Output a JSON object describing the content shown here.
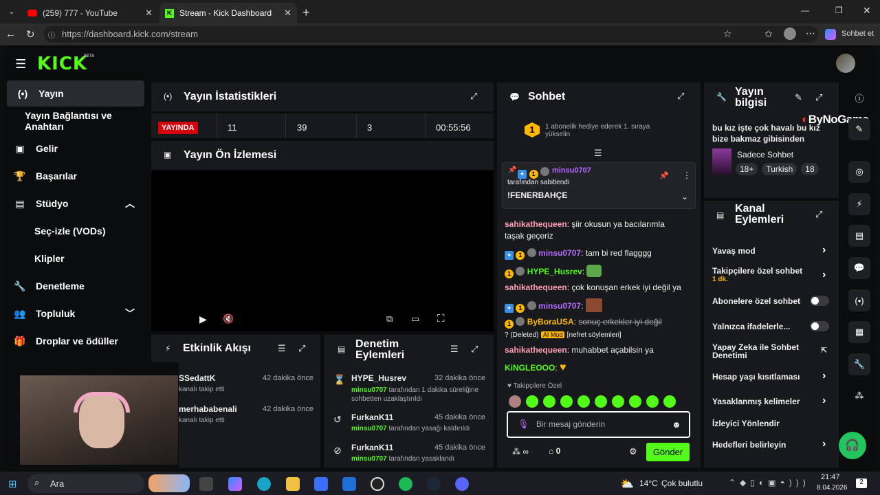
{
  "browser": {
    "tabs": [
      {
        "title": "(259) 777 - YouTube",
        "active": false
      },
      {
        "title": "Stream - Kick Dashboard",
        "active": true
      }
    ],
    "url": "https://dashboard.kick.com/stream",
    "copilot_label": "Sohbet et"
  },
  "brand": {
    "logo": "KICK",
    "beta": "BETA",
    "color": "#53fc18"
  },
  "sidebar": {
    "items": [
      {
        "label": "Yayın",
        "icon": "broadcast-icon",
        "active": true
      },
      {
        "label": "Yayın Bağlantısı ve Anahtarı",
        "icon": ""
      },
      {
        "label": "Gelir",
        "icon": "wallet-icon"
      },
      {
        "label": "Başarılar",
        "icon": "trophy-icon"
      },
      {
        "label": "Stüdyo",
        "icon": "studio-icon"
      },
      {
        "label": "Seç-izle (VODs)",
        "icon": ""
      },
      {
        "label": "Klipler",
        "icon": ""
      },
      {
        "label": "Denetleme",
        "icon": "wrench-icon"
      },
      {
        "label": "Topluluk",
        "icon": "people-icon"
      },
      {
        "label": "Droplar ve ödüller",
        "icon": "gift-icon"
      }
    ]
  },
  "stats": {
    "title": "Yayın İstatistikleri",
    "status": "YAYINDA",
    "values": [
      "11",
      "39",
      "3",
      "00:55:56"
    ]
  },
  "preview": {
    "title": "Yayın Ön İzlemesi"
  },
  "activity": {
    "title": "Etkinlik Akışı",
    "items": [
      {
        "user": "SSedattK",
        "time": "42 dakika önce",
        "desc": "kanalı takip etti"
      },
      {
        "user": "merhababenali",
        "time": "42 dakika önce",
        "desc": "kanalı takip etti"
      }
    ]
  },
  "moderation": {
    "title": "Denetim Eylemleri",
    "items": [
      {
        "user": "HYPE_Husrev",
        "time": "32 dakika önce",
        "actor": "minsu0707",
        "desc": "tarafından 1 dakika süreliğine sohbetten uzaklaştırıldı"
      },
      {
        "user": "FurkanK11",
        "time": "45 dakika önce",
        "actor": "minsu0707",
        "desc": "tarafından yasağı kaldırıldı"
      },
      {
        "user": "FurkanK11",
        "time": "45 dakika önce",
        "actor": "minsu0707",
        "desc": "tarafından yasaklandı"
      }
    ]
  },
  "chat": {
    "title": "Sohbet",
    "sub_gift": "1 abonelik hediye ederek 1. sıraya yükselin",
    "sub_rank": "1",
    "pinned": {
      "user": "minsu0707",
      "by": "tarafından sabitlendi",
      "text": "!FENERBAHÇE"
    },
    "messages": [
      {
        "user": "sahikathequeen",
        "text": "şiir okusun ya bacılarımla taşak geçeriz"
      },
      {
        "user": "minsu0707",
        "text": "tam bi red flagggg"
      },
      {
        "user": "HYPE_Husrev",
        "text": ""
      },
      {
        "user": "sahikathequeen",
        "text": "çok konuşan erkek iyi değil ya"
      },
      {
        "user": "minsu0707",
        "text": ""
      },
      {
        "user": "ByBoraUSA",
        "text": "sonuç erkekler iyi değil"
      },
      {
        "user": "sahikathequeen",
        "text": "muhabbet açabilsin ya"
      },
      {
        "user": "KiNGLEOOO",
        "text": ""
      }
    ],
    "deleted_label": "? (Deleted)",
    "ai_mod": "AI Mod",
    "reason": "[nefret söylemleri]",
    "followers_only": "Takipçilere Özel",
    "placeholder": "Bir mesaj gönderin",
    "points": "∞",
    "chest_count": "0",
    "send_label": "Gönder"
  },
  "stream_info": {
    "title": "Yayın bilgisi",
    "stream_title": "bu kız işte çok havalı bu kız bize bakmaz gibisinden",
    "category": "Sadece Sohbet",
    "tags": [
      "18+",
      "Turkish",
      "18"
    ],
    "watermark": "ByNoGame"
  },
  "channel_actions": {
    "title": "Kanal Eylemleri",
    "items": [
      {
        "label": "Yavaş mod",
        "control": "chevron"
      },
      {
        "label": "Takipçilere özel sohbet",
        "sub": "1 dk.",
        "control": "chevron"
      },
      {
        "label": "Abonelere özel sohbet",
        "control": "toggle"
      },
      {
        "label": "Yalnızca ifadelerle...",
        "control": "toggle"
      },
      {
        "label": "Yapay Zeka ile Sohbet Denetimi",
        "control": "external"
      },
      {
        "label": "Hesap yaşı kısıtlaması",
        "control": "chevron"
      },
      {
        "label": "Yasaklanmış kelimeler",
        "control": "chevron"
      },
      {
        "label": "İzleyici Yönlendir",
        "control": "none"
      },
      {
        "label": "Hedefleri belirleyin",
        "control": "chevron"
      }
    ]
  },
  "taskbar": {
    "search": "Ara",
    "weather": "14°C",
    "weather_desc": "Çok bulutlu",
    "time": "21:47",
    "date": "8.04.2026",
    "notif": "2"
  }
}
